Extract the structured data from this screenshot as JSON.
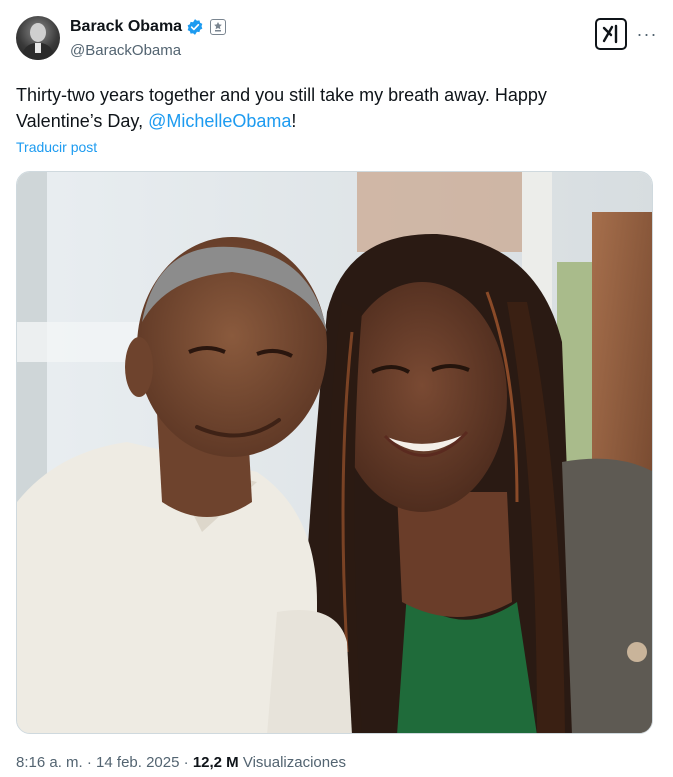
{
  "author": {
    "name": "Barack Obama",
    "handle": "@BarackObama",
    "avatar_icon": "profile-photo",
    "verified_icon": "verified-badge-icon",
    "affiliation_icon": "government-seal-icon",
    "verified_color": "#1d9bf0"
  },
  "header_actions": {
    "grok_icon": "grok-icon",
    "more_icon": "more-options-icon",
    "more_label": "···"
  },
  "tweet": {
    "text_before": "Thirty-two years together and you still take my breath away. Happy Valentine’s Day, ",
    "mention": "@MichelleObama",
    "text_after": "!",
    "translate_label": "Traducir post"
  },
  "media": {
    "type": "photo",
    "description_icon": "selfie-photo"
  },
  "meta": {
    "time": "8:16 a. m.",
    "separator": "·",
    "date": "14 feb. 2025",
    "views_count": "12,2 M",
    "views_label": "Visualizaciones"
  },
  "colors": {
    "link": "#1d9bf0",
    "text": "#0f1419",
    "secondary": "#536471"
  }
}
